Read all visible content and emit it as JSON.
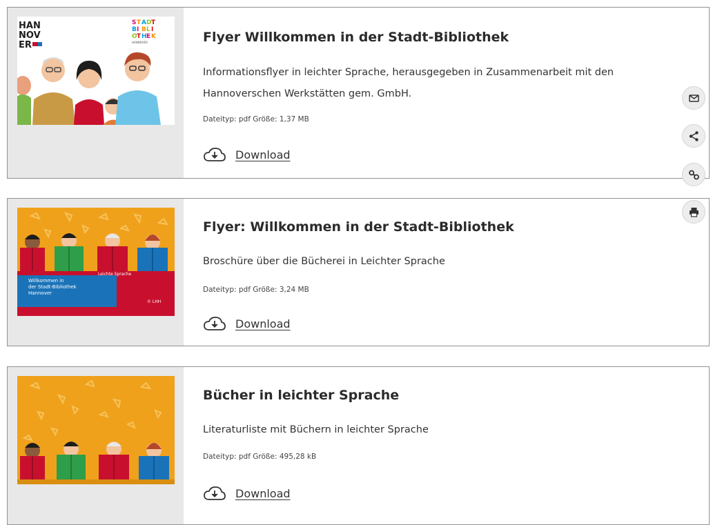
{
  "colors": {
    "card_border": "#8e9196",
    "thumb_column_bg": "#e8e8e9",
    "title_text": "#2b2b2b",
    "body_text": "#333333",
    "thumb_orange": "#f0a11c",
    "thumb_red": "#c8102e",
    "thumb_blue": "#1a73b8",
    "side_button_bg": "#ededed"
  },
  "items": [
    {
      "title": "Flyer Willkommen in der Stadt-Bibliothek",
      "description": "Informationsflyer in leichter Sprache, herausgegeben in Zusammenarbeit mit den Hannoverschen Werkstätten gem. GmbH.",
      "meta": "Dateityp: pdf Größe: 1,37 MB",
      "download_label": "Download",
      "thumbnail": {
        "logo_left": "HAN NOV ER",
        "logo_right": "STADT BIBLIOTHEK HANNOVER"
      }
    },
    {
      "title": "Flyer: Willkommen in der Stadt-Bibliothek",
      "description": "Broschüre über die Bücherei in Leichter Sprache",
      "meta": "Dateityp: pdf Größe: 3,24 MB",
      "download_label": "Download",
      "thumbnail": {
        "banner_tag": "Leichte Sprache",
        "banner_text": "Willkommen in der Stadt-Bibliothek Hannover",
        "copyright": "© LHH"
      }
    },
    {
      "title": "Bücher in leichter Sprache",
      "description": "Literaturliste mit Büchern in leichter Sprache",
      "meta": "Dateityp: pdf Größe: 495,28 kB",
      "download_label": "Download"
    }
  ],
  "side_actions": [
    {
      "icon": "mail-icon"
    },
    {
      "icon": "share-icon"
    },
    {
      "icon": "link-icon"
    },
    {
      "icon": "print-icon"
    }
  ]
}
